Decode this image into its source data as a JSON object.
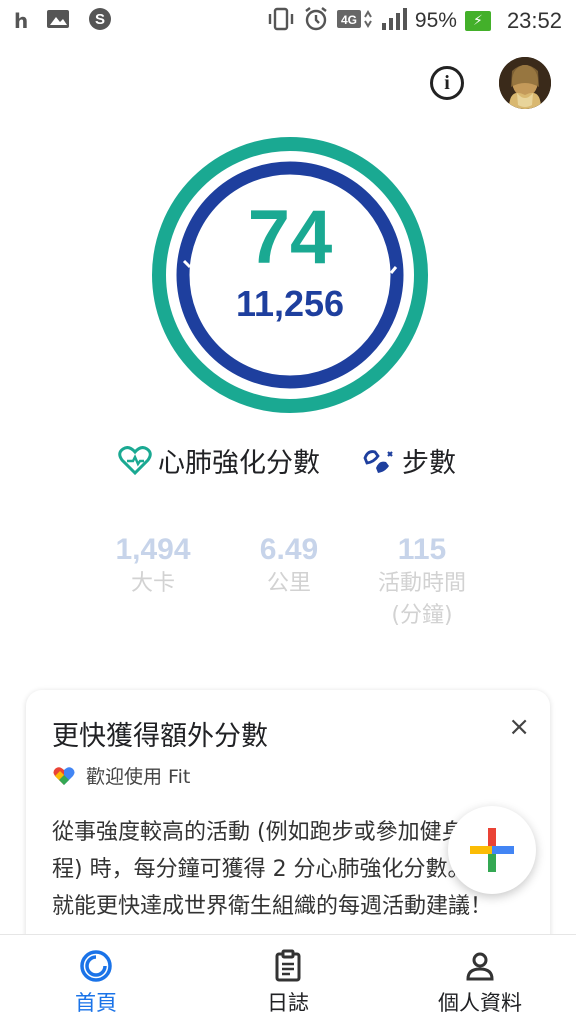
{
  "status_bar": {
    "battery_percent": "95%",
    "time": "23:52",
    "network": "4G"
  },
  "ring": {
    "heart_points": "74",
    "steps": "11,256",
    "colors": {
      "heart": "#1aa992",
      "steps": "#1e3f9e"
    }
  },
  "legends": {
    "heart_label": "心肺強化分數",
    "steps_label": "步數"
  },
  "stats": [
    {
      "value": "1,494",
      "label": "大卡"
    },
    {
      "value": "6.49",
      "label": "公里"
    },
    {
      "value": "115",
      "label": "活動時間",
      "label2": "(分鐘)"
    }
  ],
  "card": {
    "title": "更快獲得額外分數",
    "source": "歡迎使用 Fit",
    "body": "從事強度較高的活動 (例如跑步或參加健身輪課程) 時，每分鐘可獲得 2 分心肺強化分數。這樣就能更快達成世界衛生組織的每週活動建議！",
    "close_symbol": "×"
  },
  "nav": {
    "items": [
      {
        "label": "首頁",
        "icon": "home-ring-icon",
        "active": true
      },
      {
        "label": "日誌",
        "icon": "journal-icon"
      },
      {
        "label": "個人資料",
        "icon": "profile-icon"
      }
    ]
  },
  "accent": "#1a73e8"
}
